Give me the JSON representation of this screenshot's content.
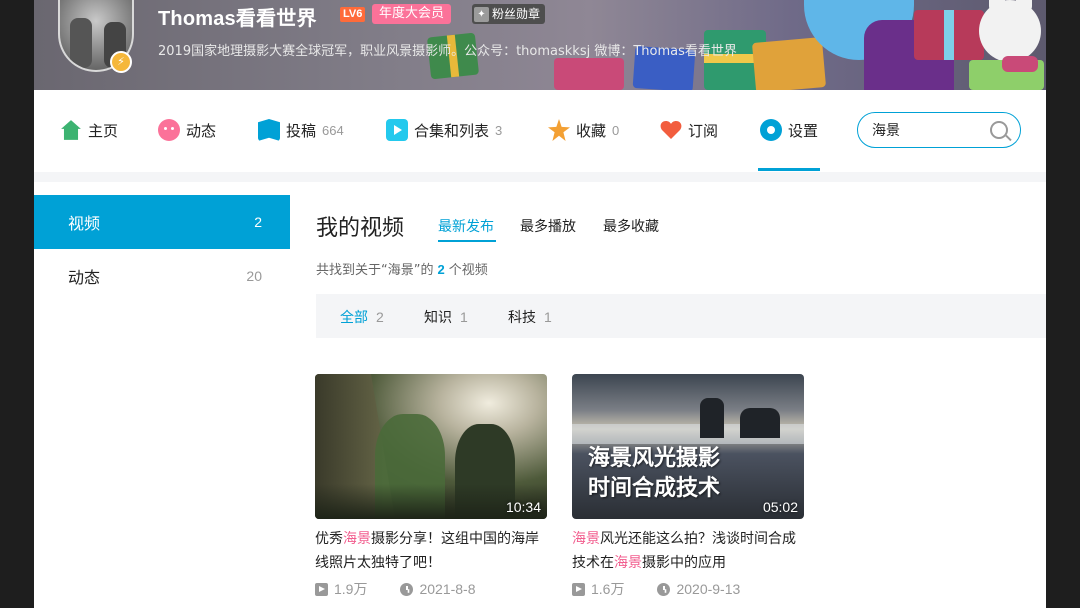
{
  "profile": {
    "name": "Thomas看看世界",
    "level": "LV6",
    "vip_label": "年度大会员",
    "fans_medal_label": "粉丝勋章",
    "signature": "2019国家地理摄影大赛全球冠军，职业风景摄影师。公众号：thomaskksj 微博：Thomas看看世界"
  },
  "nav": {
    "items": [
      {
        "label": "主页",
        "count": "",
        "icon": "home-icon"
      },
      {
        "label": "动态",
        "count": "",
        "icon": "dynamic-icon"
      },
      {
        "label": "投稿",
        "count": "664",
        "icon": "upload-icon"
      },
      {
        "label": "合集和列表",
        "count": "3",
        "icon": "collection-icon"
      },
      {
        "label": "收藏",
        "count": "0",
        "icon": "favorite-icon"
      },
      {
        "label": "订阅",
        "count": "",
        "icon": "subscribe-icon"
      },
      {
        "label": "设置",
        "count": "",
        "icon": "settings-icon"
      }
    ],
    "search_value": "海景"
  },
  "sidebar": {
    "items": [
      {
        "label": "视频",
        "count": "2",
        "active": true
      },
      {
        "label": "动态",
        "count": "20",
        "active": false
      }
    ]
  },
  "main": {
    "title": "我的视频",
    "sort_tabs": [
      "最新发布",
      "最多播放",
      "最多收藏"
    ],
    "found": {
      "prefix": "共找到关于“海景”的",
      "count": "2",
      "suffix": "个视频"
    },
    "filters": [
      {
        "label": "全部",
        "count": "2"
      },
      {
        "label": "知识",
        "count": "1"
      },
      {
        "label": "科技",
        "count": "1"
      }
    ]
  },
  "videos": [
    {
      "duration": "10:34",
      "title_parts": [
        "优秀",
        "海景",
        "摄影分享！这组中国的海岸线照片太独特了吧！"
      ],
      "views": "1.9万",
      "date": "2021-8-8"
    },
    {
      "duration": "05:02",
      "overlay_line1": "海景风光摄影",
      "overlay_line2": "时间合成技术",
      "title_parts": [
        "",
        "海景",
        "风光还能这么拍？浅谈时间合成技术在",
        "海景",
        "摄影中的应用"
      ],
      "views": "1.6万",
      "date": "2020-9-13"
    }
  ],
  "colors": {
    "accent": "#00a1d6",
    "highlight": "#f25d8e",
    "vip": "#fb7299"
  }
}
